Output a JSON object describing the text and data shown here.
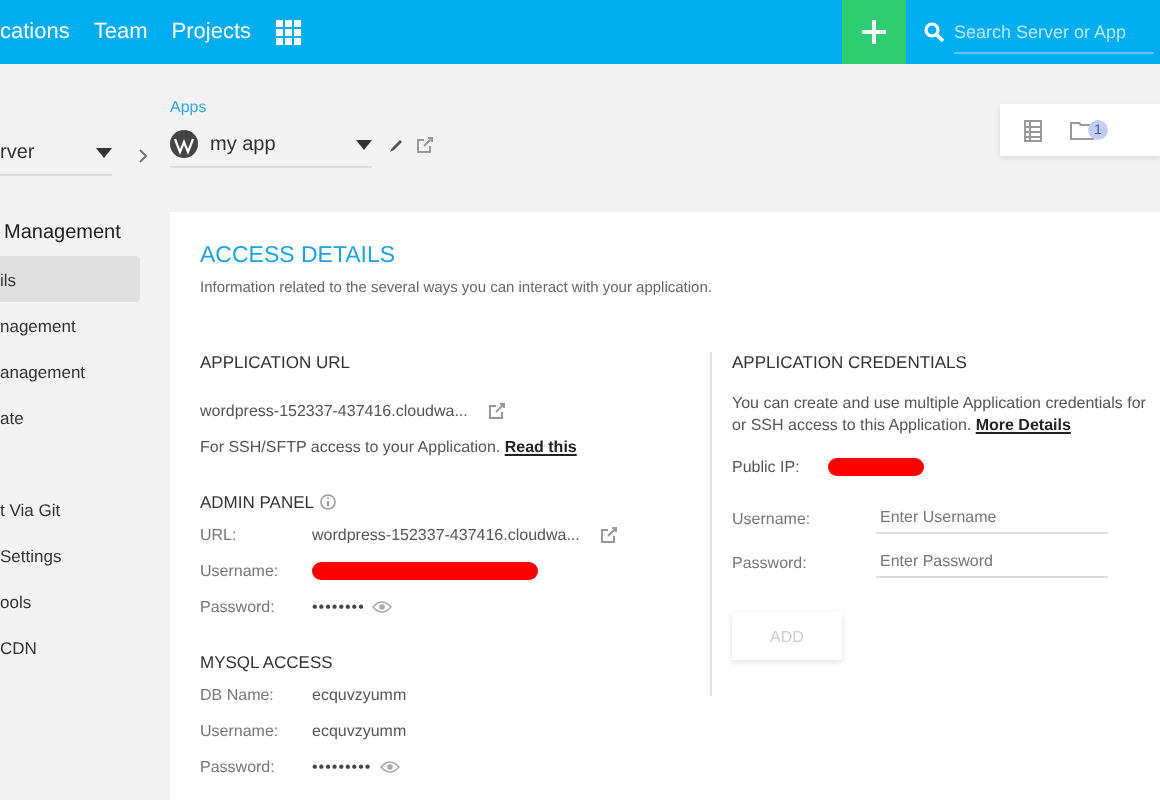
{
  "nav": {
    "links": [
      {
        "label": "cations"
      },
      {
        "label": "Team"
      },
      {
        "label": "Projects"
      }
    ],
    "search": {
      "placeholder": "Search Server or App"
    }
  },
  "breadcrumb": {
    "server": {
      "value": "rver"
    },
    "app": {
      "label": "Apps",
      "value": "my app"
    },
    "folder_count": "1"
  },
  "sidebar": {
    "heading": "Management",
    "items": [
      {
        "label": "ils",
        "selected": true
      },
      {
        "label": "nagement",
        "selected": false
      },
      {
        "label": "anagement",
        "selected": false
      },
      {
        "label": "ate",
        "selected": false
      },
      {
        "label": "t Via Git",
        "selected": false
      },
      {
        "label": "Settings",
        "selected": false
      },
      {
        "label": "ools",
        "selected": false
      },
      {
        "label": "CDN",
        "selected": false
      }
    ]
  },
  "access": {
    "title": "ACCESS DETAILS",
    "description": "Information related to the several ways you can interact with your application.",
    "application_url": {
      "heading": "APPLICATION URL",
      "url": "wordpress-152337-437416.cloudwa...",
      "note": "For SSH/SFTP access to your Application.",
      "link": "Read this"
    },
    "admin_panel": {
      "heading": "ADMIN PANEL",
      "rows": [
        {
          "label": "URL:",
          "kind": "link",
          "value": "wordpress-152337-437416.cloudwa..."
        },
        {
          "label": "Username:",
          "kind": "redacted"
        },
        {
          "label": "Password:",
          "kind": "secret",
          "value": "••••••••"
        }
      ]
    },
    "mysql": {
      "heading": "MYSQL ACCESS",
      "rows": [
        {
          "label": "DB Name:",
          "kind": "text",
          "value": "ecquvzyumm"
        },
        {
          "label": "Username:",
          "kind": "text",
          "value": "ecquvzyumm"
        },
        {
          "label": "Password:",
          "kind": "secret",
          "value": "•••••••••"
        }
      ]
    },
    "credentials": {
      "heading": "APPLICATION CREDENTIALS",
      "text": "You can create and use multiple Application credentials for or SSH access to this Application.",
      "link": "More Details",
      "public_ip": {
        "label": "Public IP:",
        "kind": "redacted"
      },
      "fields": [
        {
          "label": "Username:",
          "placeholder": "Enter Username"
        },
        {
          "label": "Password:",
          "placeholder": "Enter Password"
        }
      ],
      "button": {
        "label": "ADD",
        "disabled": true
      }
    }
  }
}
